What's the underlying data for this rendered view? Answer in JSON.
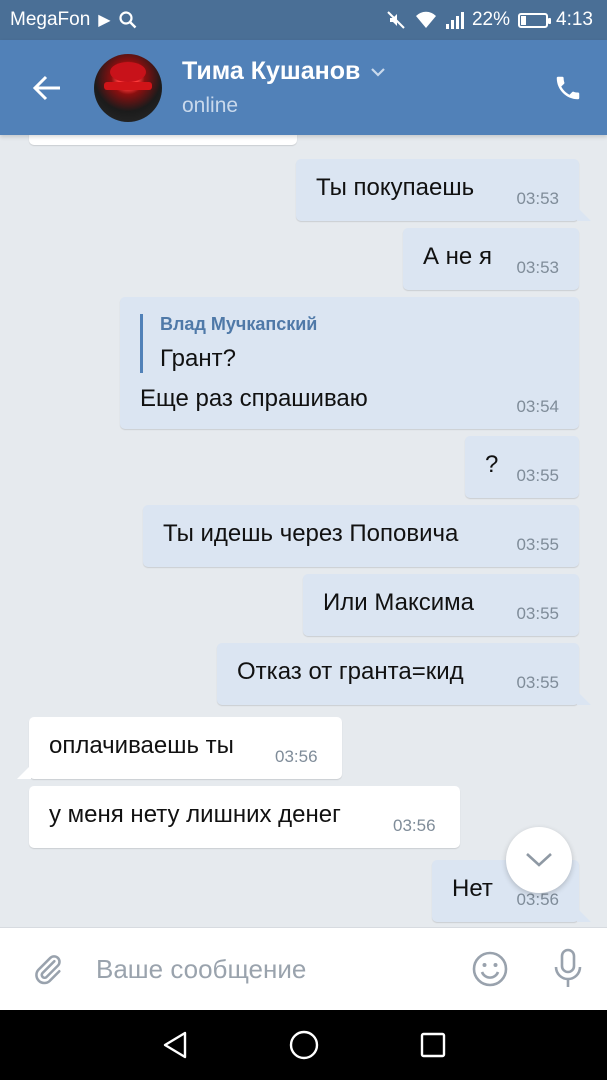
{
  "status_bar": {
    "carrier": "MegaFon",
    "battery": "22%",
    "battery_level": 0.22,
    "time": "4:13",
    "icons": [
      "play-icon",
      "search-icon",
      "mute-icon",
      "wifi-icon",
      "signal-icon",
      "battery-icon"
    ]
  },
  "header": {
    "name": "Тима Кушанов",
    "status": "online",
    "icons": [
      "back-arrow-icon",
      "chevron-down-icon",
      "phone-icon"
    ]
  },
  "messages": [
    {
      "dir": "in",
      "text": ""
    },
    {
      "dir": "out",
      "text": "Ты покупаешь",
      "time": "03:53"
    },
    {
      "dir": "out",
      "text": "А не я",
      "time": "03:53"
    },
    {
      "dir": "out",
      "reply": {
        "author": "Влад Мучкапский",
        "text": "Грант?"
      },
      "text": "Еще раз спрашиваю",
      "time": "03:54"
    },
    {
      "dir": "out",
      "text": "?",
      "time": "03:55"
    },
    {
      "dir": "out",
      "text": "Ты идешь через Поповича",
      "time": "03:55"
    },
    {
      "dir": "out",
      "text": "Или Максима",
      "time": "03:55"
    },
    {
      "dir": "out",
      "text": "Отказ от гранта=кид",
      "time": "03:55"
    },
    {
      "dir": "in",
      "text": "оплачиваешь ты",
      "time": "03:56"
    },
    {
      "dir": "in",
      "text": "у меня нету лишних денег",
      "time": "03:56"
    },
    {
      "dir": "out",
      "text": "Нет",
      "time": "03:56"
    }
  ],
  "composer": {
    "placeholder": "Ваше сообщение",
    "value": ""
  },
  "colors": {
    "status_bar": "#4a6f96",
    "header": "#5181b8",
    "background": "#e6eaee",
    "outgoing_bubble": "#dbe5f2",
    "incoming_bubble": "#ffffff",
    "accent": "#5181b8",
    "icon_gray": "#99a2ad"
  }
}
